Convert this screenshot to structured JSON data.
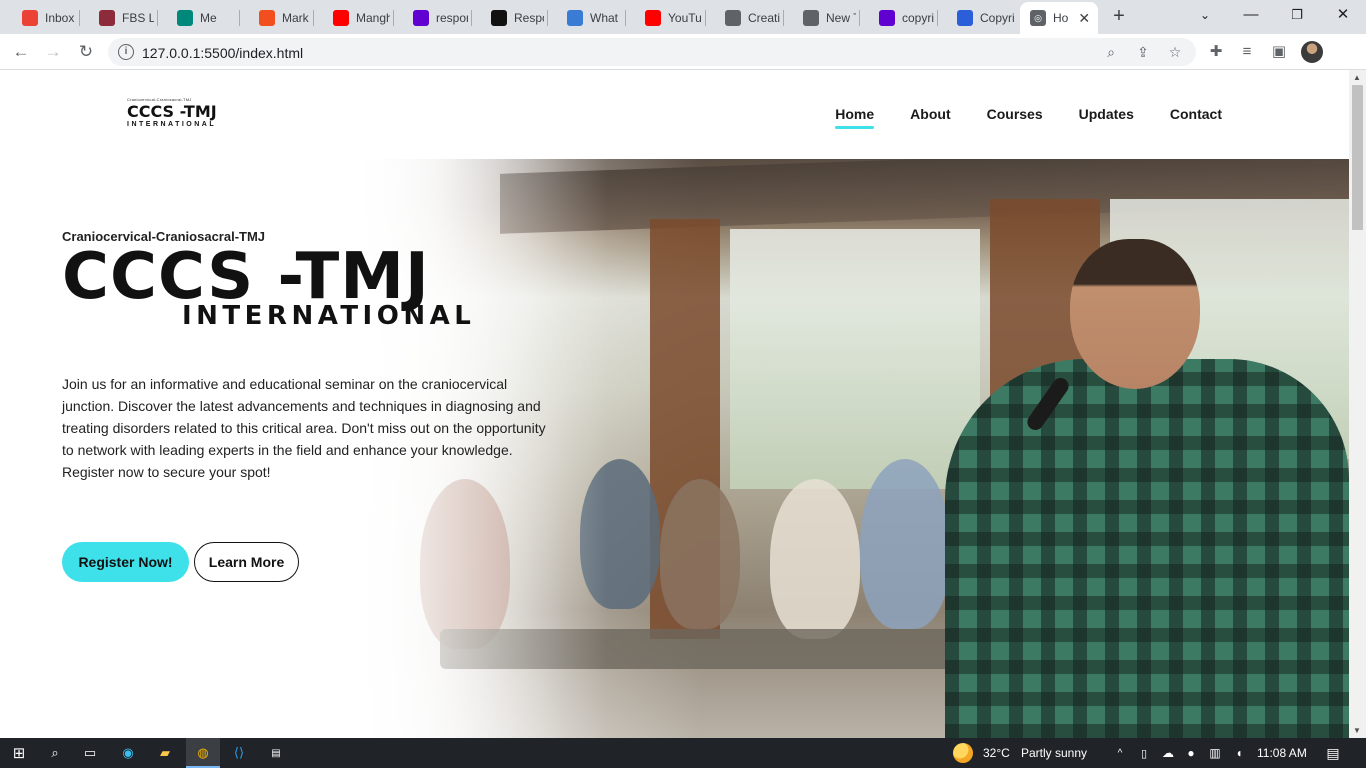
{
  "browser": {
    "tabs": [
      {
        "title": "Inbox (",
        "icon": "gmail-icon",
        "color": "#ea4335"
      },
      {
        "title": "FBS Lea",
        "icon": "fbs-icon",
        "color": "#8e2b3b"
      },
      {
        "title": "Me",
        "icon": "google-meet-icon",
        "color": "#00897b"
      },
      {
        "title": "Mark Jo",
        "icon": "figma-icon",
        "color": "#f24e1e"
      },
      {
        "title": "Mangh",
        "icon": "youtube-icon",
        "color": "#ff0000"
      },
      {
        "title": "respon",
        "icon": "yahoo-icon",
        "color": "#6001d2"
      },
      {
        "title": "Respon",
        "icon": "medium-icon",
        "color": "#111111"
      },
      {
        "title": "What Is",
        "icon": "fx-icon",
        "color": "#3a7bd5"
      },
      {
        "title": "YouTub",
        "icon": "youtube-icon",
        "color": "#ff0000"
      },
      {
        "title": "Creativ",
        "icon": "globe-icon",
        "color": "#5f6368"
      },
      {
        "title": "New Ta",
        "icon": "globe-icon",
        "color": "#5f6368"
      },
      {
        "title": "copyrig",
        "icon": "yahoo-icon",
        "color": "#6001d2"
      },
      {
        "title": "Copyri",
        "icon": "s-icon",
        "color": "#2b5fd9"
      }
    ],
    "active_tab": {
      "title": "Ho",
      "icon": "globe-icon"
    },
    "url": "127.0.0.1:5500/index.html"
  },
  "site": {
    "logo": {
      "tiny": "Craniocervical-Craniosacral-TMJ",
      "main": "CCCS -TMJ",
      "sub": "INTERNATIONAL"
    },
    "menu": [
      "Home",
      "About",
      "Courses",
      "Updates",
      "Contact"
    ],
    "active_menu": "Home",
    "hero": {
      "eyebrow": "Craniocervical-Craniosacral-TMJ",
      "title": "CCCS -TMJ",
      "subtitle": "INTERNATIONAL",
      "description": "Join us for an informative and educational seminar on the craniocervical junction. Discover the latest advancements and techniques in diagnosing and treating disorders related to this critical area. Don't miss out on the opportunity to network with leading experts in the field and enhance your knowledge. Register now to secure your spot!",
      "primary_button": "Register Now!",
      "secondary_button": "Learn More"
    },
    "accent_color": "#3ee0ea"
  },
  "taskbar": {
    "weather": {
      "temp": "32°C",
      "condition": "Partly sunny"
    },
    "time": "11:08 AM"
  }
}
